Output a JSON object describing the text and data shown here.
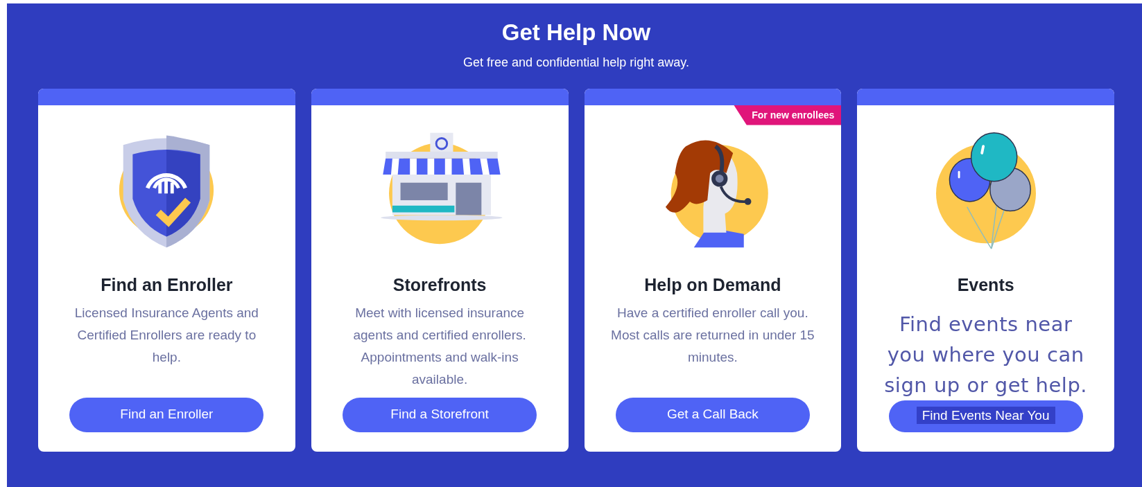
{
  "header": {
    "title": "Get Help Now",
    "subtitle": "Get free and confidential help right away."
  },
  "cards": [
    {
      "title": "Find an Enroller",
      "description": "Licensed Insurance Agents and Certified Enrollers are ready to help.",
      "button": "Find an Enroller",
      "kind": "standard"
    },
    {
      "title": "Storefronts",
      "description": "Meet with licensed insurance agents and certified enrollers. Appointments and walk-ins available.",
      "button": "Find a Storefront",
      "kind": "standard"
    },
    {
      "title": "Help on Demand",
      "description": "Have a certified enroller call you. Most calls are returned in under 15 minutes.",
      "button": "Get a Call Back",
      "kind": "standard",
      "badge": "For new enrollees"
    },
    {
      "title": "Events",
      "description": "Find events near you where you can sign up or get help.",
      "button": "Find Events Near You",
      "kind": "custom"
    }
  ]
}
